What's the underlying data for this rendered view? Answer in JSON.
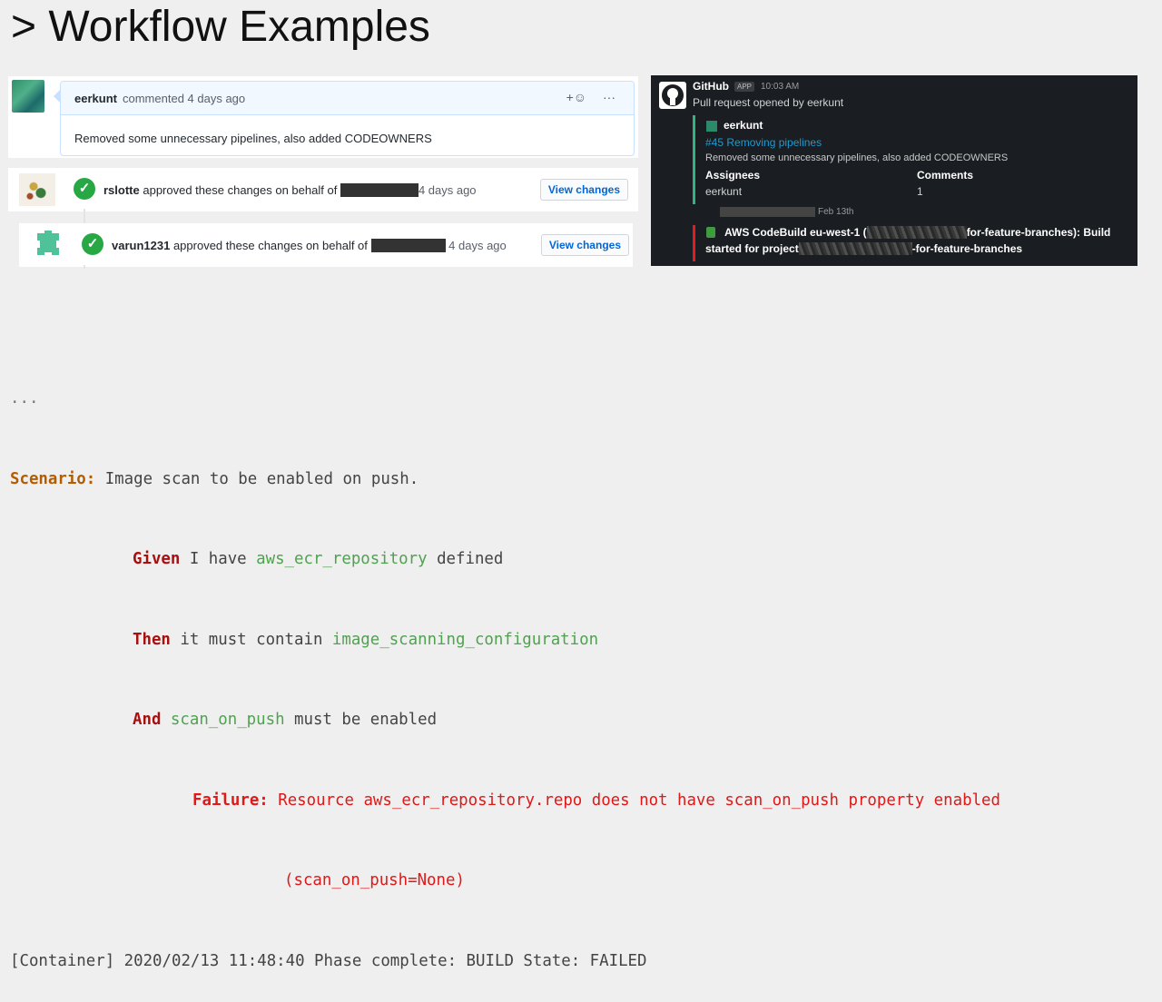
{
  "page": {
    "title": "> Workflow Examples"
  },
  "github": {
    "comment": {
      "author": "eerkunt",
      "meta": "commented 4 days ago",
      "add_reaction": "+☺",
      "more": "···",
      "body": "Removed some unnecessary pipelines, also added CODEOWNERS"
    },
    "reviews": [
      {
        "reviewer": "rslotte",
        "action": "approved these changes on behalf of",
        "time": "4 days ago",
        "button": "View changes"
      },
      {
        "reviewer": "varun1231",
        "action": "approved these changes on behalf of",
        "time": "4 days ago",
        "button": "View changes"
      }
    ]
  },
  "slack": {
    "sender": "GitHub",
    "app_badge": "APP",
    "time": "10:03 AM",
    "subtitle": "Pull request opened by eerkunt",
    "attachment": {
      "user": "eerkunt",
      "link": "#45 Removing pipelines",
      "description": "Removed some unnecessary pipelines, also added CODEOWNERS",
      "fields": [
        {
          "label": "Assignees",
          "value": "eerkunt"
        },
        {
          "label": "Comments",
          "value": "1"
        }
      ]
    },
    "second_date": "Feb 13th",
    "codebuild": {
      "line1_start": "AWS CodeBuild eu-west-1 (",
      "line1_end": "for-feature-branches): Build",
      "line2_start": "started for project",
      "line2_end": "-for-feature-branches"
    }
  },
  "console": {
    "ellipsis": "...",
    "scenario_kw": "Scenario:",
    "scenario_text": " Image scan to be enabled on push.",
    "steps": [
      {
        "kw": "Given",
        "pre": " I have ",
        "hl": "aws_ecr_repository",
        "post": " defined"
      },
      {
        "kw": "Then",
        "pre": " it must contain ",
        "hl": "image_scanning_configuration",
        "post": ""
      },
      {
        "kw": "And",
        "pre": " ",
        "hl": "scan_on_push",
        "post": " must be enabled"
      }
    ],
    "failure_kw": "Failure:",
    "failure_msg1": " Resource aws_ecr_repository.repo does not have scan_on_push property enabled",
    "failure_msg2": "(scan_on_push=None)",
    "final": "[Container] 2020/02/13 11:48:40 Phase complete: BUILD State: FAILED"
  },
  "colors": {
    "keyword_scenario": "#b35c00",
    "keyword_step": "#a81010",
    "identifier": "#4fa24f",
    "failure": "#e01818",
    "slack_bg": "#1a1d21",
    "github_check": "#28a745"
  }
}
